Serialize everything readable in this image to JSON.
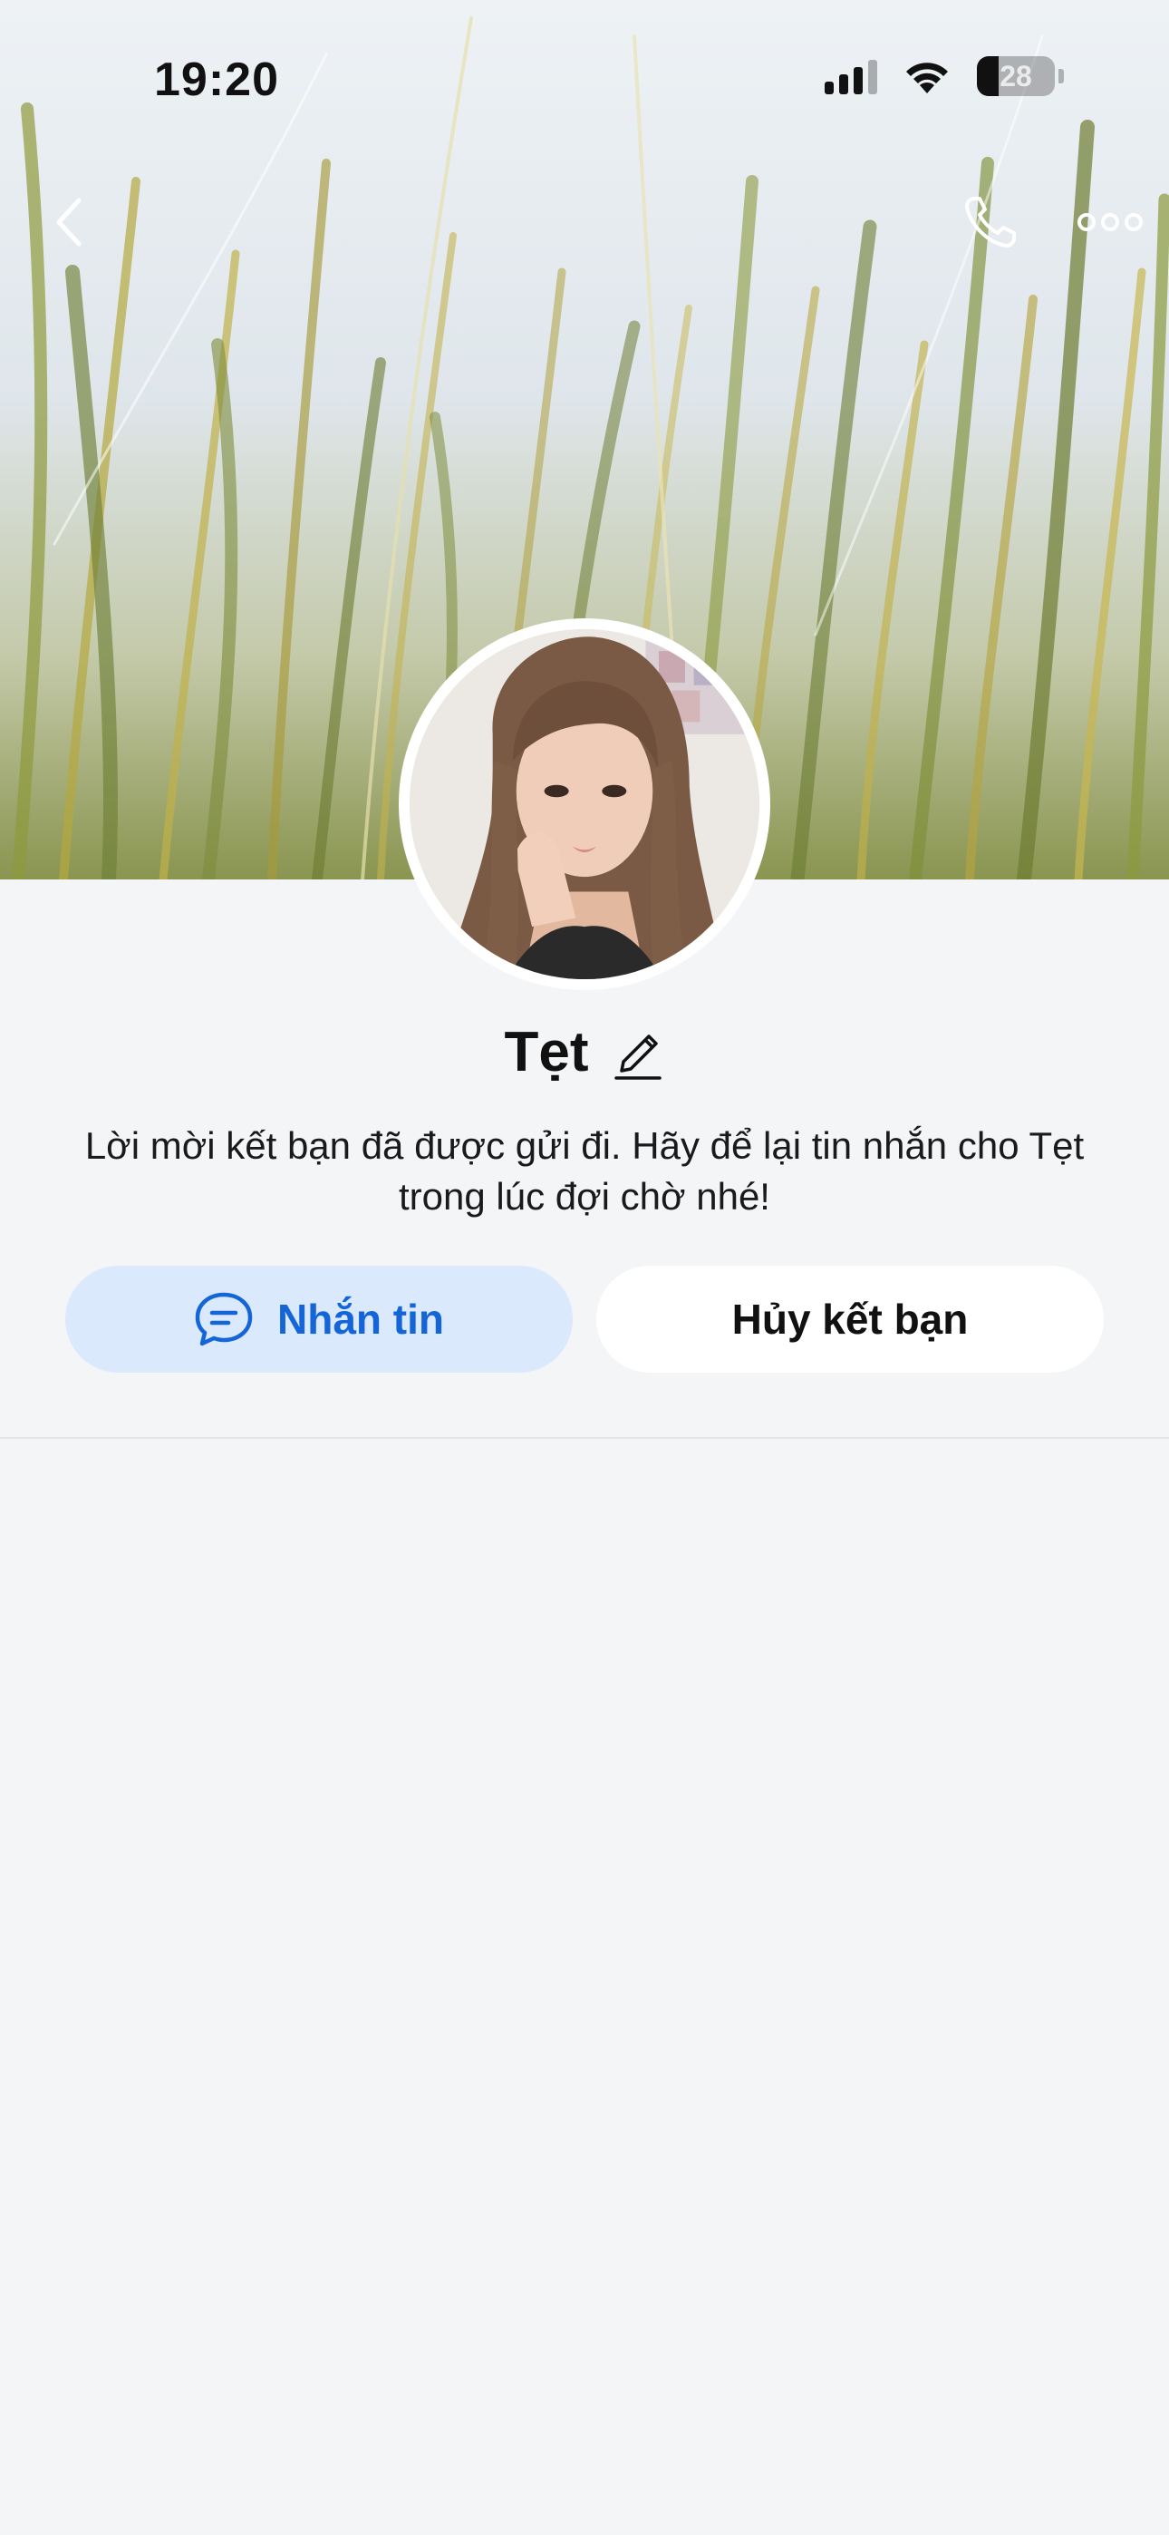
{
  "status_bar": {
    "time": "19:20",
    "battery_level": "28",
    "icons": [
      "signal-icon",
      "wifi-icon",
      "battery-icon"
    ]
  },
  "nav": {
    "back_icon": "chevron-left-icon",
    "call_icon": "phone-icon",
    "more_icon": "more-dots-icon"
  },
  "profile": {
    "name": "Tẹt",
    "edit_icon": "pencil-icon",
    "friend_request_message": "Lời mời kết bạn đã được gửi đi. Hãy để lại tin nhắn cho Tẹt trong lúc đợi chờ nhé!"
  },
  "actions": {
    "message_label": "Nhắn tin",
    "message_icon": "chat-bubble-icon",
    "cancel_request_label": "Hủy kết bạn"
  },
  "colors": {
    "accent": "#1466d8",
    "message_button_bg": "#dbe9fd",
    "background": "#f4f5f7"
  }
}
